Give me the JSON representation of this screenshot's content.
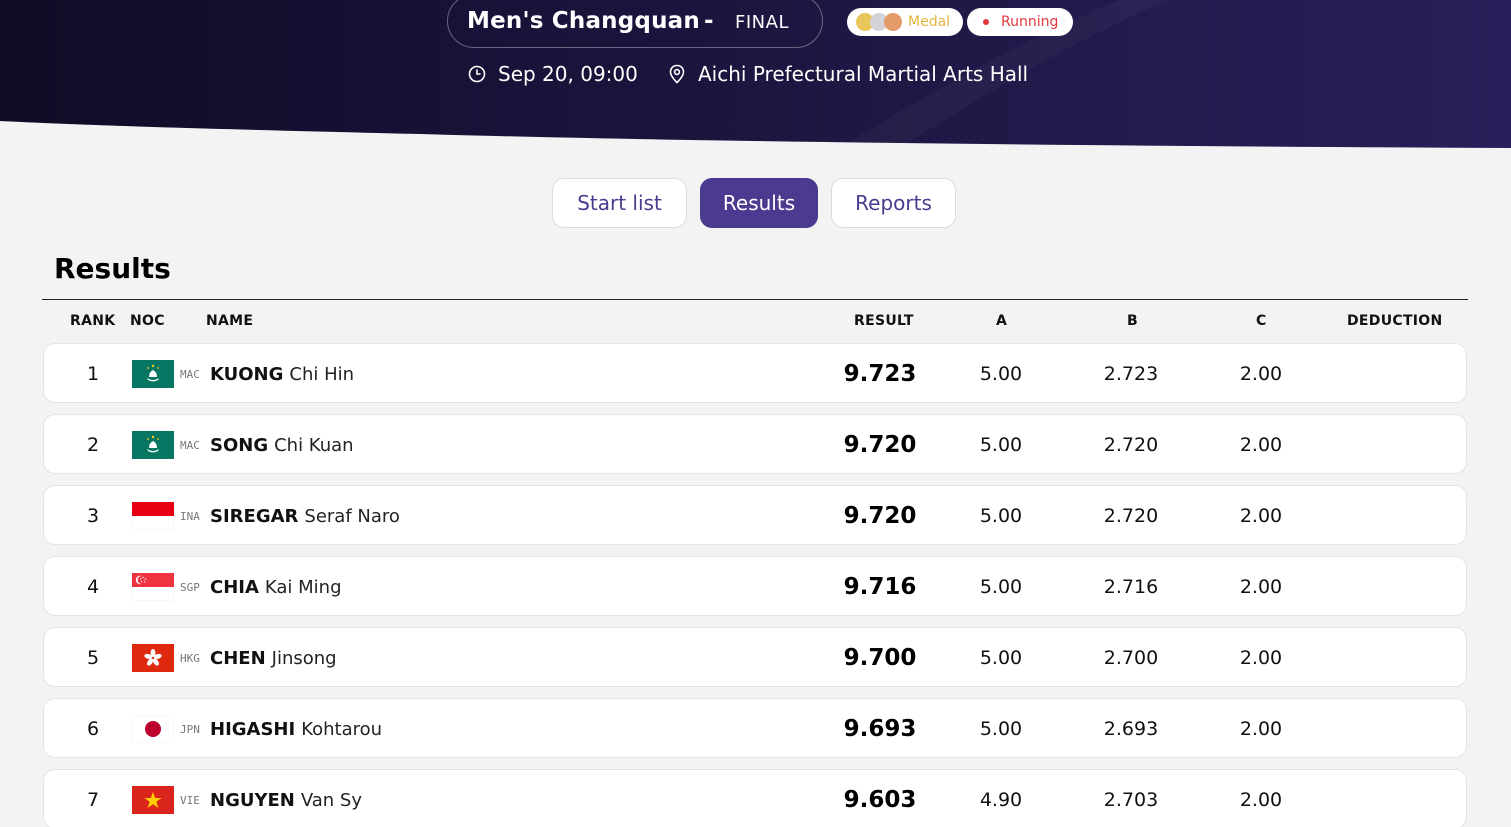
{
  "header": {
    "event_title": "Men's Changquan",
    "separator": "-",
    "phase": "FINAL",
    "medal_badge": "Medal",
    "status_badge": "Running",
    "datetime": "Sep 20, 09:00",
    "venue": "Aichi Prefectural Martial Arts Hall",
    "colors": {
      "background": "#18133a",
      "medal": "#e4b43f",
      "running": "#e0383e"
    }
  },
  "tabs": [
    {
      "label": "Start list",
      "active": false
    },
    {
      "label": "Results",
      "active": true
    },
    {
      "label": "Reports",
      "active": false
    }
  ],
  "section_title": "Results",
  "accent_color": "#4b3a8f",
  "columns": {
    "rank": "RANK",
    "noc": "NOC",
    "name": "NAME",
    "result": "RESULT",
    "a": "A",
    "b": "B",
    "c": "C",
    "deduction": "DEDUCTION"
  },
  "rows": [
    {
      "rank": "1",
      "noc": "MAC",
      "flag": "macau-flag-icon",
      "surname": "KUONG",
      "given": "Chi Hin",
      "result": "9.723",
      "a": "5.00",
      "b": "2.723",
      "c": "2.00",
      "deduction": ""
    },
    {
      "rank": "2",
      "noc": "MAC",
      "flag": "macau-flag-icon",
      "surname": "SONG",
      "given": "Chi Kuan",
      "result": "9.720",
      "a": "5.00",
      "b": "2.720",
      "c": "2.00",
      "deduction": ""
    },
    {
      "rank": "3",
      "noc": "INA",
      "flag": "indonesia-flag-icon",
      "surname": "SIREGAR",
      "given": "Seraf Naro",
      "result": "9.720",
      "a": "5.00",
      "b": "2.720",
      "c": "2.00",
      "deduction": ""
    },
    {
      "rank": "4",
      "noc": "SGP",
      "flag": "singapore-flag-icon",
      "surname": "CHIA",
      "given": "Kai Ming",
      "result": "9.716",
      "a": "5.00",
      "b": "2.716",
      "c": "2.00",
      "deduction": ""
    },
    {
      "rank": "5",
      "noc": "HKG",
      "flag": "hong-kong-flag-icon",
      "surname": "CHEN",
      "given": "Jinsong",
      "result": "9.700",
      "a": "5.00",
      "b": "2.700",
      "c": "2.00",
      "deduction": ""
    },
    {
      "rank": "6",
      "noc": "JPN",
      "flag": "japan-flag-icon",
      "surname": "HIGASHI",
      "given": "Kohtarou",
      "result": "9.693",
      "a": "5.00",
      "b": "2.693",
      "c": "2.00",
      "deduction": ""
    },
    {
      "rank": "7",
      "noc": "VIE",
      "flag": "vietnam-flag-icon",
      "surname": "NGUYEN",
      "given": "Van Sy",
      "result": "9.603",
      "a": "4.90",
      "b": "2.703",
      "c": "2.00",
      "deduction": ""
    }
  ]
}
